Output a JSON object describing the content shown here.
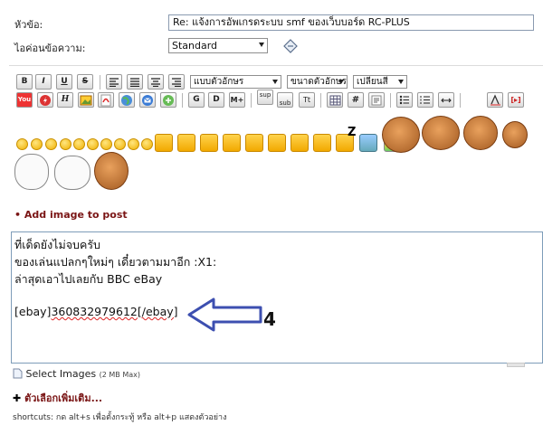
{
  "form": {
    "subject_label": "หัวข้อ:",
    "subject_value": "Re: แจ้งการอัพเกรดระบบ smf ของเว็บบอร์ด RC-PLUS",
    "icon_label": "ไอค่อนข้อความ:",
    "icon_value": "Standard"
  },
  "toolbar": {
    "row1": [
      "B",
      "I",
      "U",
      "S"
    ],
    "font_face": "แบบตัวอักษร",
    "font_size": "ขนาดตัวอักษร",
    "font_color": "เปลี่ยนสี",
    "row2_labels": {
      "g": "G",
      "d": "D",
      "m": "M+",
      "sup": "sup",
      "sub": "sub",
      "tt": "Tt"
    }
  },
  "add_image": "Add image to post",
  "editor": {
    "lines": [
      "ที่เด็ดยังไม่จบครับ",
      "ของเล่นแปลกๆใหม่ๆ เดี๋ยวตามมาอีก  :X1:",
      "ล่าสุดเอาไปเลยกับ BBC eBay"
    ],
    "code_open": "[ebay]",
    "code_number": "360832979612",
    "code_close": "[/ebay]"
  },
  "annotation": {
    "number": "4",
    "arrow_color": "#3d4fb0"
  },
  "select_images": "Select Images",
  "select_images_max": "(2 MB Max)",
  "more_options": "ตัวเลือกเพิ่มเติม...",
  "shortcuts": "shortcuts: กด alt+s เพื่อตั้งกระทู้ หรือ alt+p แสดงตัวอย่าง",
  "colors": {
    "accent_dark_red": "#7a1515",
    "editor_border": "#7e9db9"
  }
}
